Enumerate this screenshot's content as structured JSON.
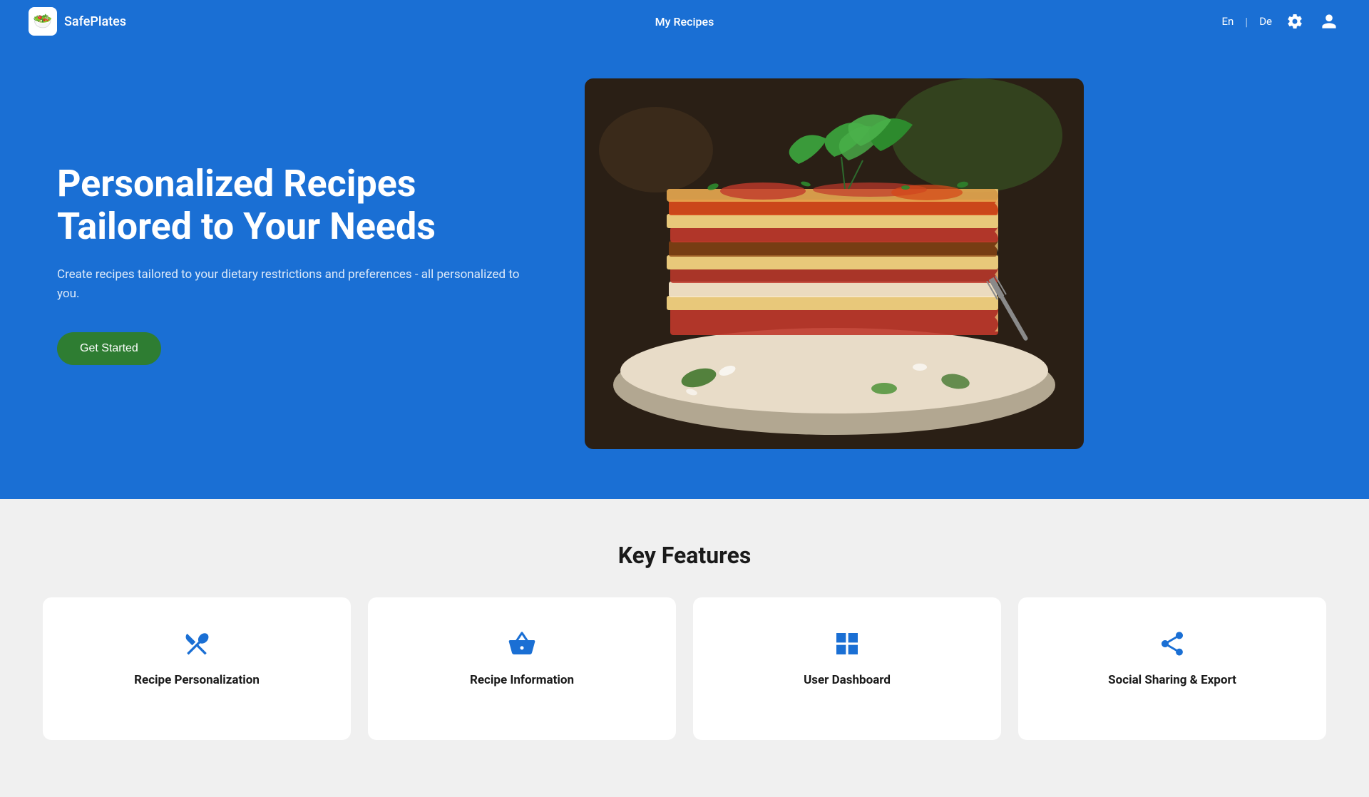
{
  "header": {
    "logo_icon": "🥗",
    "logo_text": "SafePlates",
    "nav_link": "My Recipes",
    "lang_en": "En",
    "lang_separator": "|",
    "lang_de": "De"
  },
  "hero": {
    "title": "Personalized Recipes Tailored to Your Needs",
    "subtitle": "Create recipes tailored to your dietary restrictions and preferences - all personalized to you.",
    "cta_label": "Get Started"
  },
  "features": {
    "section_title": "Key Features",
    "cards": [
      {
        "icon": "utensils",
        "label": "Recipe Personalization"
      },
      {
        "icon": "basket",
        "label": "Recipe Information"
      },
      {
        "icon": "dashboard",
        "label": "User Dashboard"
      },
      {
        "icon": "share",
        "label": "Social Sharing & Export"
      }
    ]
  }
}
